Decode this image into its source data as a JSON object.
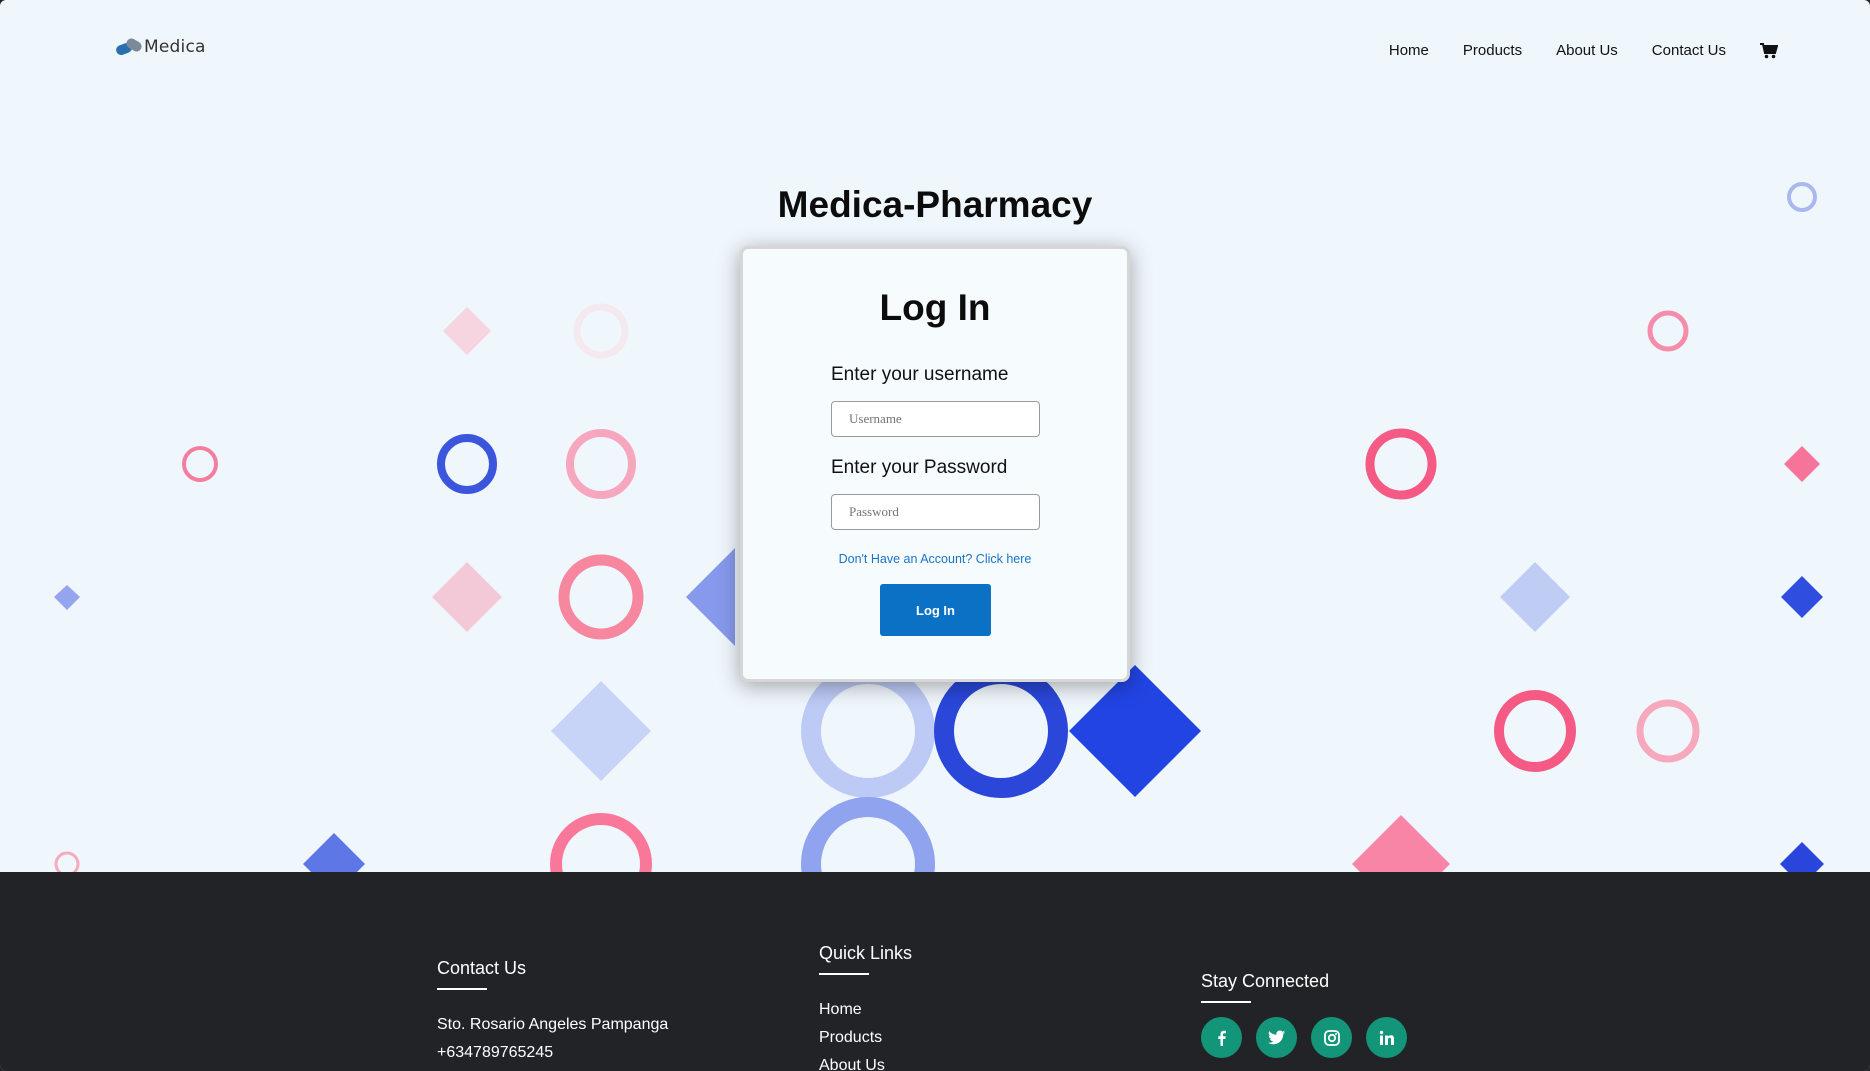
{
  "header": {
    "logo_text": "Medica",
    "nav": [
      "Home",
      "Products",
      "About Us",
      "Contact Us"
    ]
  },
  "hero": {
    "title": "Medica-Pharmacy"
  },
  "login": {
    "heading": "Log In",
    "username_label": "Enter your username",
    "username_placeholder": "Username",
    "password_label": "Enter your Password",
    "password_placeholder": "Password",
    "signup_link": "Don't Have an Account? Click here",
    "submit_label": "Log In"
  },
  "footer": {
    "contact": {
      "heading": "Contact Us",
      "address": "Sto. Rosario Angeles Pampanga",
      "phone": "+634789765245"
    },
    "quick_links": {
      "heading": "Quick Links",
      "links": [
        "Home",
        "Products",
        "About Us"
      ]
    },
    "social": {
      "heading": "Stay Connected",
      "icons": [
        "facebook-icon",
        "twitter-icon",
        "instagram-icon",
        "linkedin-icon"
      ]
    }
  },
  "colors": {
    "primary_button": "#0b71c5",
    "link": "#1a73c7",
    "footer_bg": "#222327",
    "social_bg": "#13957a",
    "hero_bg": "#f0f7fc"
  }
}
